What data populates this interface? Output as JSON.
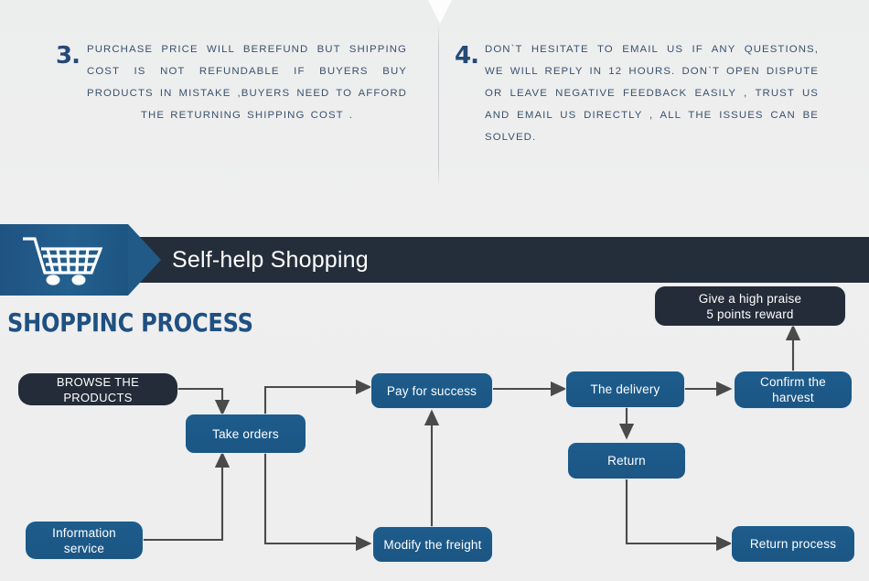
{
  "terms": [
    {
      "number": "3.",
      "text": "PURCHASE PRICE WILL BEREFUND BUT SHIPPING COST IS NOT REFUNDABLE IF BUYERS BUY PRODUCTS IN MISTAKE ,BUYERS NEED TO AFFORD THE RETURNING SHIPPING COST ."
    },
    {
      "number": "4.",
      "text": "DON`T HESITATE TO EMAIL US IF ANY QUESTIONS, WE WILL REPLY IN 12 HOURS. DON`T OPEN DISPUTE OR LEAVE NEGATIVE FEEDBACK EASILY , TRUST US AND EMAIL US DIRECTLY , ALL THE ISSUES CAN BE SOLVED."
    }
  ],
  "banner": {
    "title": "Self-help Shopping",
    "icon": "shopping-cart-icon",
    "bar_color": "#242e3a",
    "arrow_color": "#215a87"
  },
  "section": {
    "title": "SHOPPINC PROCESS",
    "title_color": "#1f5082"
  },
  "flowchart": {
    "type": "flowchart",
    "colors": {
      "node_blue": "#1d5c8c",
      "node_dark": "#232c38",
      "connector": "#4a4a4a",
      "background": "#eeeeee"
    },
    "nodes": [
      {
        "id": "browse",
        "label": "BROWSE THE PRODUCTS",
        "style": "dark"
      },
      {
        "id": "take-orders",
        "label": "Take orders",
        "style": "blue"
      },
      {
        "id": "info",
        "label": "Information service",
        "style": "blue"
      },
      {
        "id": "pay",
        "label": "Pay for success",
        "style": "blue"
      },
      {
        "id": "modify",
        "label": "Modify the freight",
        "style": "blue"
      },
      {
        "id": "delivery",
        "label": "The delivery",
        "style": "blue"
      },
      {
        "id": "return",
        "label": "Return",
        "style": "blue"
      },
      {
        "id": "confirm",
        "label": "Confirm the harvest",
        "style": "blue"
      },
      {
        "id": "praise",
        "label": "Give a high praise 5 points reward",
        "style": "dark"
      },
      {
        "id": "return-proc",
        "label": "Return process",
        "style": "blue"
      }
    ],
    "edges": [
      {
        "from": "browse",
        "to": "take-orders"
      },
      {
        "from": "info",
        "to": "take-orders"
      },
      {
        "from": "take-orders",
        "to": "pay"
      },
      {
        "from": "take-orders",
        "to": "modify"
      },
      {
        "from": "modify",
        "to": "pay"
      },
      {
        "from": "pay",
        "to": "delivery"
      },
      {
        "from": "delivery",
        "to": "confirm"
      },
      {
        "from": "delivery",
        "to": "return"
      },
      {
        "from": "confirm",
        "to": "praise"
      },
      {
        "from": "return",
        "to": "return-proc"
      }
    ]
  },
  "labels": {
    "browse": "BROWSE THE PRODUCTS",
    "take_orders": "Take orders",
    "info_line1": "Information",
    "info_line2": "service",
    "pay": "Pay for success",
    "modify": "Modify the freight",
    "delivery": "The delivery",
    "return": "Return",
    "confirm_line1": "Confirm the",
    "confirm_line2": "harvest",
    "praise_line1": "Give a high praise",
    "praise_line2": "5 points reward",
    "return_process": "Return process"
  }
}
